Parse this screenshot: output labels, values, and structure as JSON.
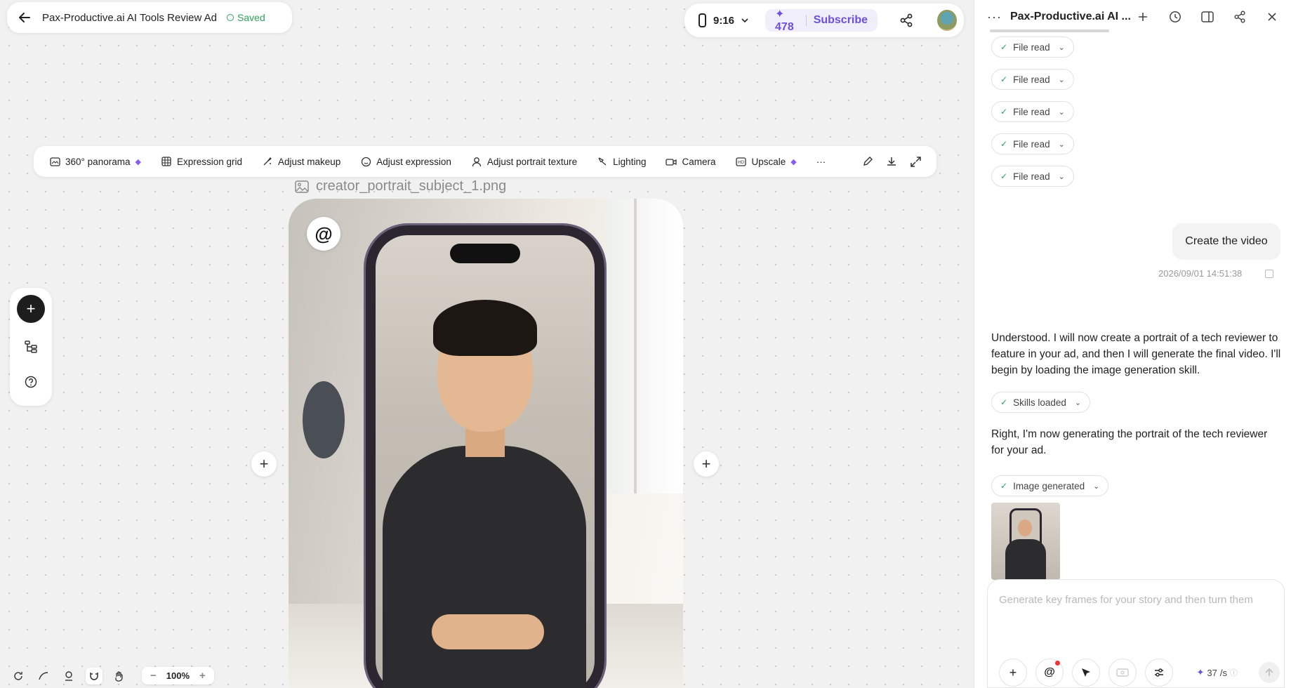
{
  "header": {
    "project_title": "Pax-Productive.ai AI Tools Review Ad",
    "saved_label": "Saved",
    "aspect_ratio": "9:16",
    "credits": "478",
    "subscribe_label": "Subscribe"
  },
  "toolbar": {
    "tools": [
      {
        "label": "360° panorama",
        "icon": "panorama-icon",
        "premium": true
      },
      {
        "label": "Expression grid",
        "icon": "grid-icon",
        "premium": false
      },
      {
        "label": "Adjust makeup",
        "icon": "makeup-brush-icon",
        "premium": false
      },
      {
        "label": "Adjust expression",
        "icon": "smile-icon",
        "premium": false
      },
      {
        "label": "Adjust portrait texture",
        "icon": "portrait-icon",
        "premium": false
      },
      {
        "label": "Lighting",
        "icon": "lighting-icon",
        "premium": false
      },
      {
        "label": "Camera",
        "icon": "camera-icon",
        "premium": false
      },
      {
        "label": "Upscale",
        "icon": "upscale-icon",
        "premium": true
      }
    ],
    "more_label": "···"
  },
  "canvas": {
    "file_name": "creator_portrait_subject_1.png",
    "at_label": "@",
    "zoom": "100%"
  },
  "panel": {
    "title": "Pax-Productive.ai AI ...",
    "file_read_label": "File read",
    "user_message": "Create the video",
    "timestamp": "2026/09/01 14:51:38",
    "assistant_message_1": "Understood. I will now create a portrait of a tech reviewer to feature in your ad, and then I will generate the final video. I'll begin by loading the image generation skill.",
    "skills_loaded_label": "Skills loaded",
    "assistant_message_2": "Right, I'm now generating the portrait of the tech reviewer for your ad.",
    "image_generated_label": "Image generated",
    "composer_placeholder": "Generate key frames for your story and then turn them",
    "rate": "37",
    "rate_unit": "/s"
  },
  "colors": {
    "accent": "#6c4fdc",
    "saved_green": "#2fa25b",
    "premium_gem": "#8a5bf0"
  }
}
